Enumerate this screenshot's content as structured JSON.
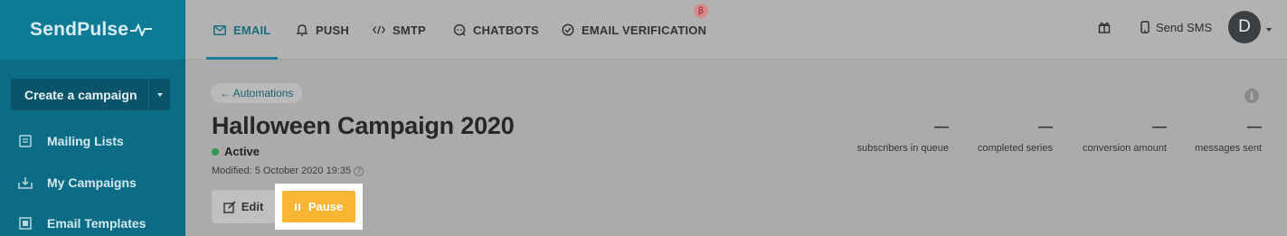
{
  "brand": {
    "name": "SendPulse"
  },
  "sidebar": {
    "create_label": "Create a campaign",
    "items": [
      {
        "label": "Mailing Lists",
        "icon": "mailing-lists-icon"
      },
      {
        "label": "My Campaigns",
        "icon": "campaigns-icon"
      },
      {
        "label": "Email Templates",
        "icon": "templates-icon"
      }
    ]
  },
  "topnav": {
    "tabs": [
      {
        "label": "EMAIL",
        "icon": "email-icon",
        "active": true
      },
      {
        "label": "PUSH",
        "icon": "bell-icon"
      },
      {
        "label": "SMTP",
        "icon": "code-icon"
      },
      {
        "label": "CHATBOTS",
        "icon": "chat-icon"
      },
      {
        "label": "EMAIL VERIFICATION",
        "icon": "check-circle-icon"
      }
    ],
    "beta_badge": "β",
    "sms_label": "Send SMS",
    "avatar_initial": "D"
  },
  "main": {
    "back_label": "← Automations",
    "title": "Halloween Campaign 2020",
    "status": "Active",
    "modified": "Modified: 5 October 2020 19:35",
    "edit_label": "Edit",
    "pause_label": "Pause",
    "stats": [
      {
        "value": "—",
        "label": "subscribers in queue"
      },
      {
        "value": "—",
        "label": "completed series"
      },
      {
        "value": "—",
        "label": "conversion amount"
      },
      {
        "value": "—",
        "label": "messages sent"
      }
    ]
  },
  "colors": {
    "sidebar": "#0c6c86",
    "accent": "#1e7c92",
    "pause": "#f8b633",
    "status_active": "#2f9a4e"
  }
}
